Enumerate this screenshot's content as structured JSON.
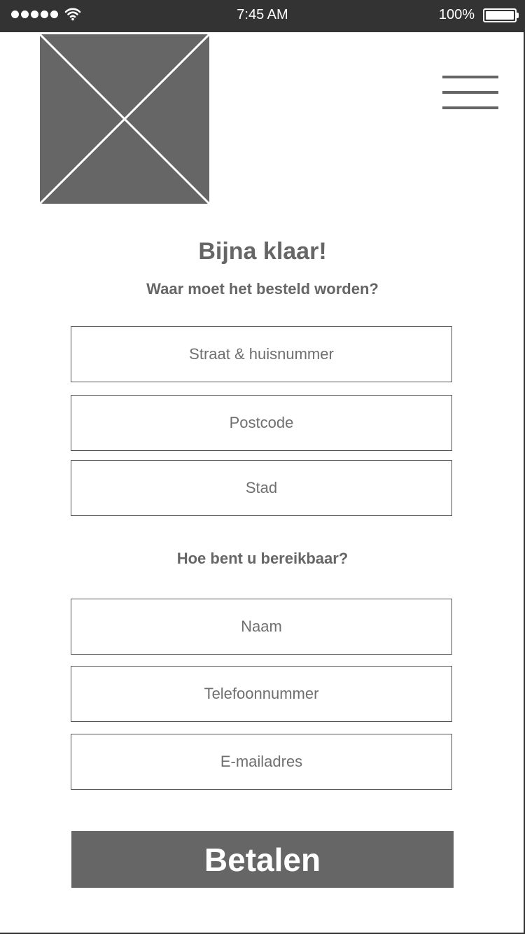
{
  "status_bar": {
    "time": "7:45 AM",
    "battery_percent": "100%",
    "battery_level": 1.0,
    "signal_icon": "signal-dots-icon",
    "wifi_icon": "wifi-icon",
    "battery_icon": "battery-icon"
  },
  "header": {
    "logo_icon": "image-placeholder-icon",
    "menu_icon": "hamburger-menu-icon"
  },
  "form": {
    "title": "Bijna klaar!",
    "address_heading": "Waar moet het besteld worden?",
    "address_fields": {
      "street": {
        "placeholder": "Straat & huisnummer",
        "value": ""
      },
      "postcode": {
        "placeholder": "Postcode",
        "value": ""
      },
      "city": {
        "placeholder": "Stad",
        "value": ""
      }
    },
    "contact_heading": "Hoe bent u bereikbaar?",
    "contact_fields": {
      "name": {
        "placeholder": "Naam",
        "value": ""
      },
      "phone": {
        "placeholder": "Telefoonnummer",
        "value": ""
      },
      "email": {
        "placeholder": "E-mailadres",
        "value": ""
      }
    },
    "pay_button_label": "Betalen"
  },
  "colors": {
    "status_bar_bg": "#333333",
    "primary_gray": "#666666",
    "background": "#ffffff"
  }
}
